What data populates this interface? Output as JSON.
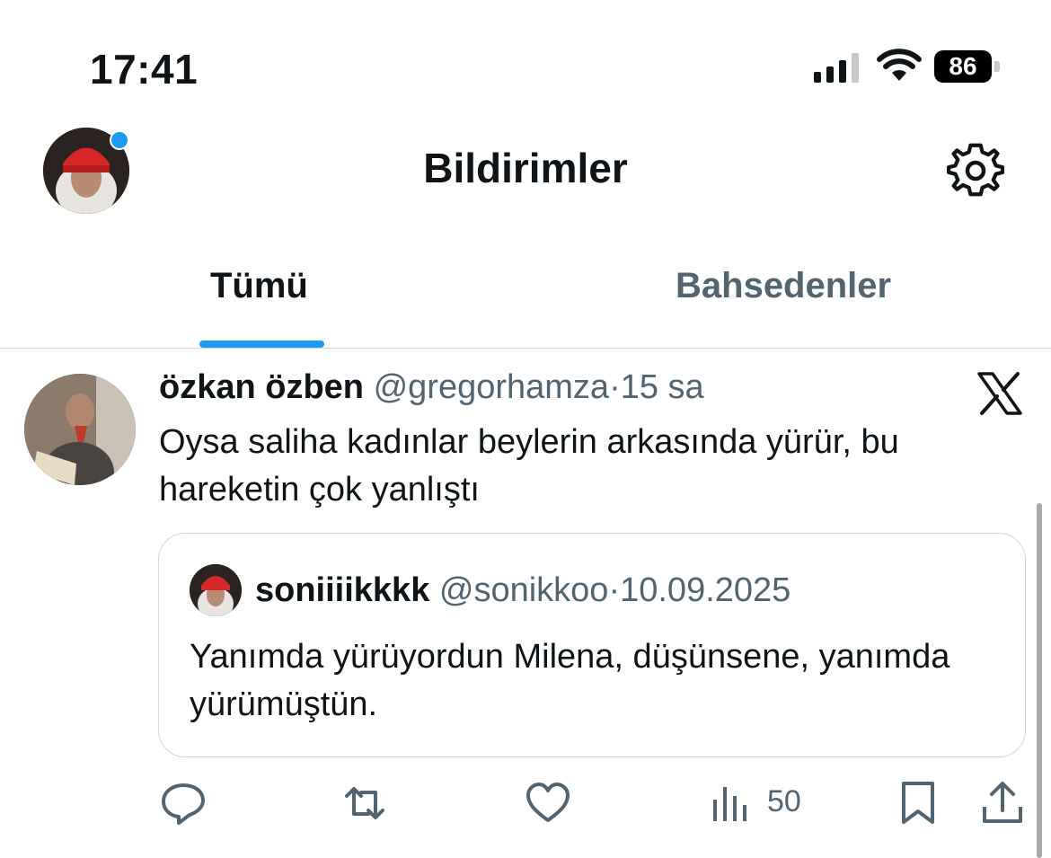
{
  "status_bar": {
    "time": "17:41",
    "battery": "86"
  },
  "header": {
    "title": "Bildirimler",
    "avatar_icon": "profile-avatar",
    "settings_icon": "gear-icon"
  },
  "tabs": [
    {
      "label": "Tümü",
      "active": true
    },
    {
      "label": "Bahsedenler",
      "active": false
    }
  ],
  "tweet": {
    "author_name": "özkan özben",
    "author_handle": "@gregorhamza",
    "separator": "·",
    "time": "15 sa",
    "text": "Oysa saliha kadınlar beylerin arkasında yürür, bu hareketin çok yanlıştı",
    "quote": {
      "author_name": "soniiiikkkk",
      "author_handle": "@sonikkoo",
      "separator": "·",
      "date": "10.09.2025",
      "text": "Yanımda yürüyordun Milena, düşünsene, yanımda yürümüştün."
    },
    "actions": {
      "views": "50"
    }
  },
  "colors": {
    "accent": "#1d9bf0",
    "secondary_text": "#536471",
    "text": "#0f1419"
  }
}
